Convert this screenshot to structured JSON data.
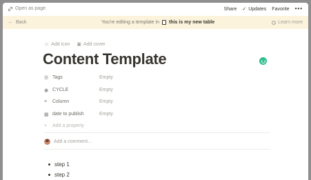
{
  "topbar": {
    "open_as_page": "Open as page",
    "share": "Share",
    "updates": "Updates",
    "favorite": "Favorite",
    "more": "•••"
  },
  "banner": {
    "back": "Back",
    "editing_text": "You're editing a template in",
    "table_name": "this is my new table",
    "learn_more": "Learn more"
  },
  "page": {
    "add_icon": "Add icon",
    "add_cover": "Add cover",
    "title": "Content Template",
    "properties": [
      {
        "name": "Tags",
        "value": "Empty",
        "icon": "list-icon"
      },
      {
        "name": "CYCLE",
        "value": "Empty",
        "icon": "select-icon"
      },
      {
        "name": "Column",
        "value": "Empty",
        "icon": "text-icon"
      },
      {
        "name": "date to publish",
        "value": "Empty",
        "icon": "calendar-icon"
      }
    ],
    "add_property": "Add a property",
    "comment_placeholder": "Add a comment...",
    "steps": [
      "step 1",
      "step 2"
    ]
  },
  "colors": {
    "banner_bg": "#fbf3db",
    "accent_spinner": "#2dbd8c",
    "text": "#37352f",
    "muted": "#a19f9a"
  }
}
